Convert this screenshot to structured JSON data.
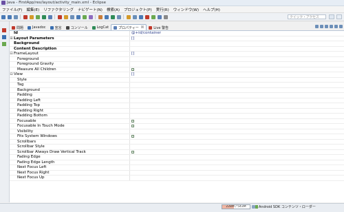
{
  "window": {
    "title": "Java - FirstApp/res/layout/activity_main.xml - Eclipse"
  },
  "menu": [
    "ファイル(F)",
    "編集(E)",
    "リファクタリング",
    "ナビゲート(N)",
    "検索(A)",
    "プロジェクト(P)",
    "実行(R)",
    "ウィンドウ(W)",
    "ヘルプ(H)"
  ],
  "toolbar": {
    "quick_access_placeholder": "クイック・アクセス"
  },
  "tabs": [
    {
      "label": "問題",
      "color": "#c0392b",
      "active": false
    },
    {
      "label": "Javadoc",
      "color": "#3a6fb0",
      "active": false
    },
    {
      "label": "宣言",
      "color": "#3a6fb0",
      "active": false
    },
    {
      "label": "コンソール",
      "color": "#444444",
      "active": false
    },
    {
      "label": "LogCat",
      "color": "#2e8b57",
      "active": false
    },
    {
      "label": "プロパティー",
      "color": "#5b7fb5",
      "active": true,
      "close": "☒"
    },
    {
      "label": "Live 警告",
      "color": "#c0392b",
      "active": false
    }
  ],
  "properties": [
    {
      "name": "Id",
      "bold": true,
      "value": "@+id/container",
      "indent": 0,
      "exp": ""
    },
    {
      "name": "Layout Parameters",
      "bold": true,
      "value": "[]",
      "indent": 0,
      "exp": "⊞"
    },
    {
      "name": "Background",
      "bold": true,
      "value": "",
      "indent": 0,
      "exp": ""
    },
    {
      "name": "Content Description",
      "bold": true,
      "value": "",
      "indent": 0,
      "exp": ""
    },
    {
      "name": "FrameLayout",
      "bold": false,
      "value": "[]",
      "indent": 0,
      "exp": "⊟"
    },
    {
      "name": "Foreground",
      "bold": false,
      "value": "",
      "indent": 1,
      "exp": ""
    },
    {
      "name": "Foreground Gravity",
      "bold": false,
      "value": "",
      "indent": 1,
      "exp": ""
    },
    {
      "name": "Measure All Children",
      "bold": false,
      "value": "",
      "check": true,
      "indent": 1,
      "exp": ""
    },
    {
      "name": "View",
      "bold": false,
      "value": "[]",
      "indent": 0,
      "exp": "⊟"
    },
    {
      "name": "Style",
      "bold": false,
      "value": "",
      "indent": 1,
      "exp": ""
    },
    {
      "name": "Tag",
      "bold": false,
      "value": "",
      "indent": 1,
      "exp": ""
    },
    {
      "name": "Background",
      "bold": false,
      "value": "",
      "indent": 1,
      "exp": ""
    },
    {
      "name": "Padding",
      "bold": false,
      "value": "",
      "indent": 1,
      "exp": ""
    },
    {
      "name": "Padding Left",
      "bold": false,
      "value": "",
      "indent": 1,
      "exp": ""
    },
    {
      "name": "Padding Top",
      "bold": false,
      "value": "",
      "indent": 1,
      "exp": ""
    },
    {
      "name": "Padding Right",
      "bold": false,
      "value": "",
      "indent": 1,
      "exp": ""
    },
    {
      "name": "Padding Bottom",
      "bold": false,
      "value": "",
      "indent": 1,
      "exp": ""
    },
    {
      "name": "Focusable",
      "bold": false,
      "value": "",
      "check": true,
      "indent": 1,
      "exp": ""
    },
    {
      "name": "Focusable In Touch Mode",
      "bold": false,
      "value": "",
      "check": true,
      "indent": 1,
      "exp": ""
    },
    {
      "name": "Visibility",
      "bold": false,
      "value": "",
      "indent": 1,
      "exp": ""
    },
    {
      "name": "Fits System Windows",
      "bold": false,
      "value": "",
      "check": true,
      "indent": 1,
      "exp": ""
    },
    {
      "name": "Scrollbars",
      "bold": false,
      "value": "",
      "indent": 1,
      "exp": ""
    },
    {
      "name": "Scrollbar Style",
      "bold": false,
      "value": "",
      "indent": 1,
      "exp": ""
    },
    {
      "name": "Scrollbar Always Draw Vertical Track",
      "bold": false,
      "value": "",
      "check": true,
      "indent": 1,
      "exp": ""
    },
    {
      "name": "Fading Edge",
      "bold": false,
      "value": "",
      "indent": 1,
      "exp": ""
    },
    {
      "name": "Fading Edge Length",
      "bold": false,
      "value": "",
      "indent": 1,
      "exp": ""
    },
    {
      "name": "Next Focus Left",
      "bold": false,
      "value": "",
      "indent": 1,
      "exp": ""
    },
    {
      "name": "Next Focus Right",
      "bold": false,
      "value": "",
      "indent": 1,
      "exp": ""
    },
    {
      "name": "Next Focus Up",
      "bold": false,
      "value": "",
      "indent": 1,
      "exp": ""
    }
  ],
  "status": {
    "heap": "228M / 543M",
    "heap_fraction": 0.42,
    "sdk_loader": "Android SDK コンテンツ・ローダー"
  }
}
